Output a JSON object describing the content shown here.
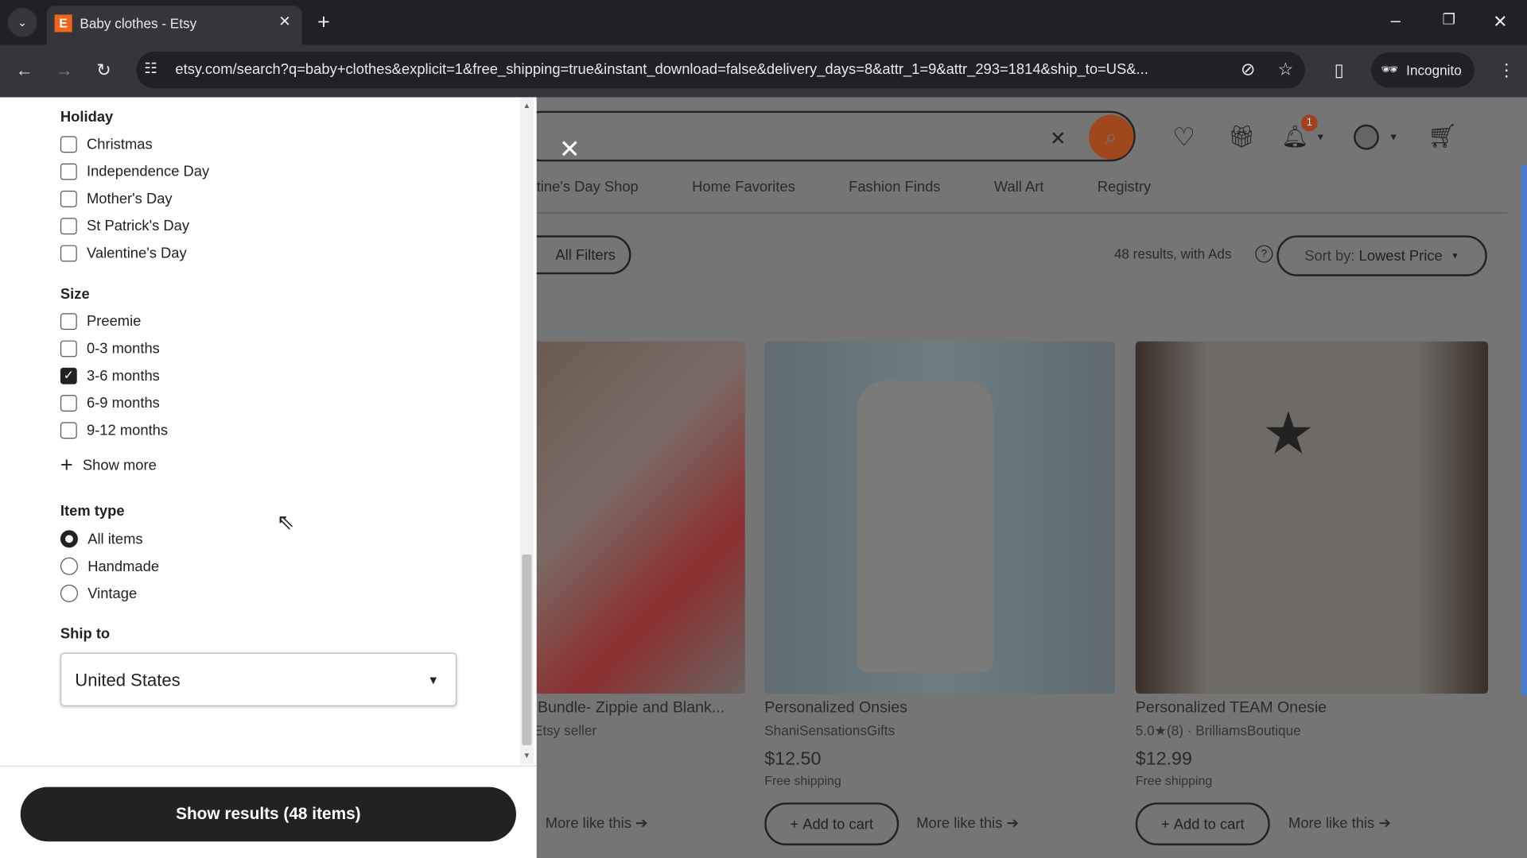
{
  "browser": {
    "tab_title": "Baby clothes - Etsy",
    "url": "etsy.com/search?q=baby+clothes&explicit=1&free_shipping=true&instant_download=false&delivery_days=8&attr_1=9&attr_293=1814&ship_to=US&...",
    "incognito_label": "Incognito"
  },
  "header": {
    "notification_count": "1",
    "nav": [
      "tine's Day Shop",
      "Home Favorites",
      "Fashion Finds",
      "Wall Art",
      "Registry"
    ],
    "all_filters": "All Filters",
    "results": "48 results, with Ads",
    "sort_label": "Sort by:",
    "sort_value": "Lowest Price"
  },
  "filters": {
    "holiday": {
      "title": "Holiday",
      "options": [
        {
          "label": "Christmas",
          "checked": false
        },
        {
          "label": "Independence Day",
          "checked": false
        },
        {
          "label": "Mother's Day",
          "checked": false
        },
        {
          "label": "St Patrick's Day",
          "checked": false
        },
        {
          "label": "Valentine's Day",
          "checked": false
        }
      ]
    },
    "size": {
      "title": "Size",
      "options": [
        {
          "label": "Preemie",
          "checked": false
        },
        {
          "label": "0-3 months",
          "checked": false
        },
        {
          "label": "3-6 months",
          "checked": true
        },
        {
          "label": "6-9 months",
          "checked": false
        },
        {
          "label": "9-12 months",
          "checked": false
        }
      ],
      "show_more": "Show more"
    },
    "item_type": {
      "title": "Item type",
      "options": [
        {
          "label": "All items",
          "selected": true
        },
        {
          "label": "Handmade",
          "selected": false
        },
        {
          "label": "Vintage",
          "selected": false
        }
      ]
    },
    "ship_to": {
      "title": "Ship to",
      "value": "United States"
    },
    "show_results": "Show results (48 items)"
  },
  "products": [
    {
      "title": "Bundle- Zippie and Blank...",
      "seller": "Etsy seller",
      "more": "More like this"
    },
    {
      "title": "Personalized Onsies",
      "seller": "ShaniSensationsGifts",
      "price": "$12.50",
      "shipping": "Free shipping",
      "add": "Add to cart",
      "more": "More like this"
    },
    {
      "title": "Personalized TEAM Onesie",
      "rating": "5.0",
      "reviews": "(8)",
      "seller": "BrilliamsBoutique",
      "price": "$12.99",
      "shipping": "Free shipping",
      "add": "Add to cart",
      "more": "More like this"
    }
  ],
  "colors": {
    "search_button": "#a0471d",
    "overlay": "#757575"
  }
}
